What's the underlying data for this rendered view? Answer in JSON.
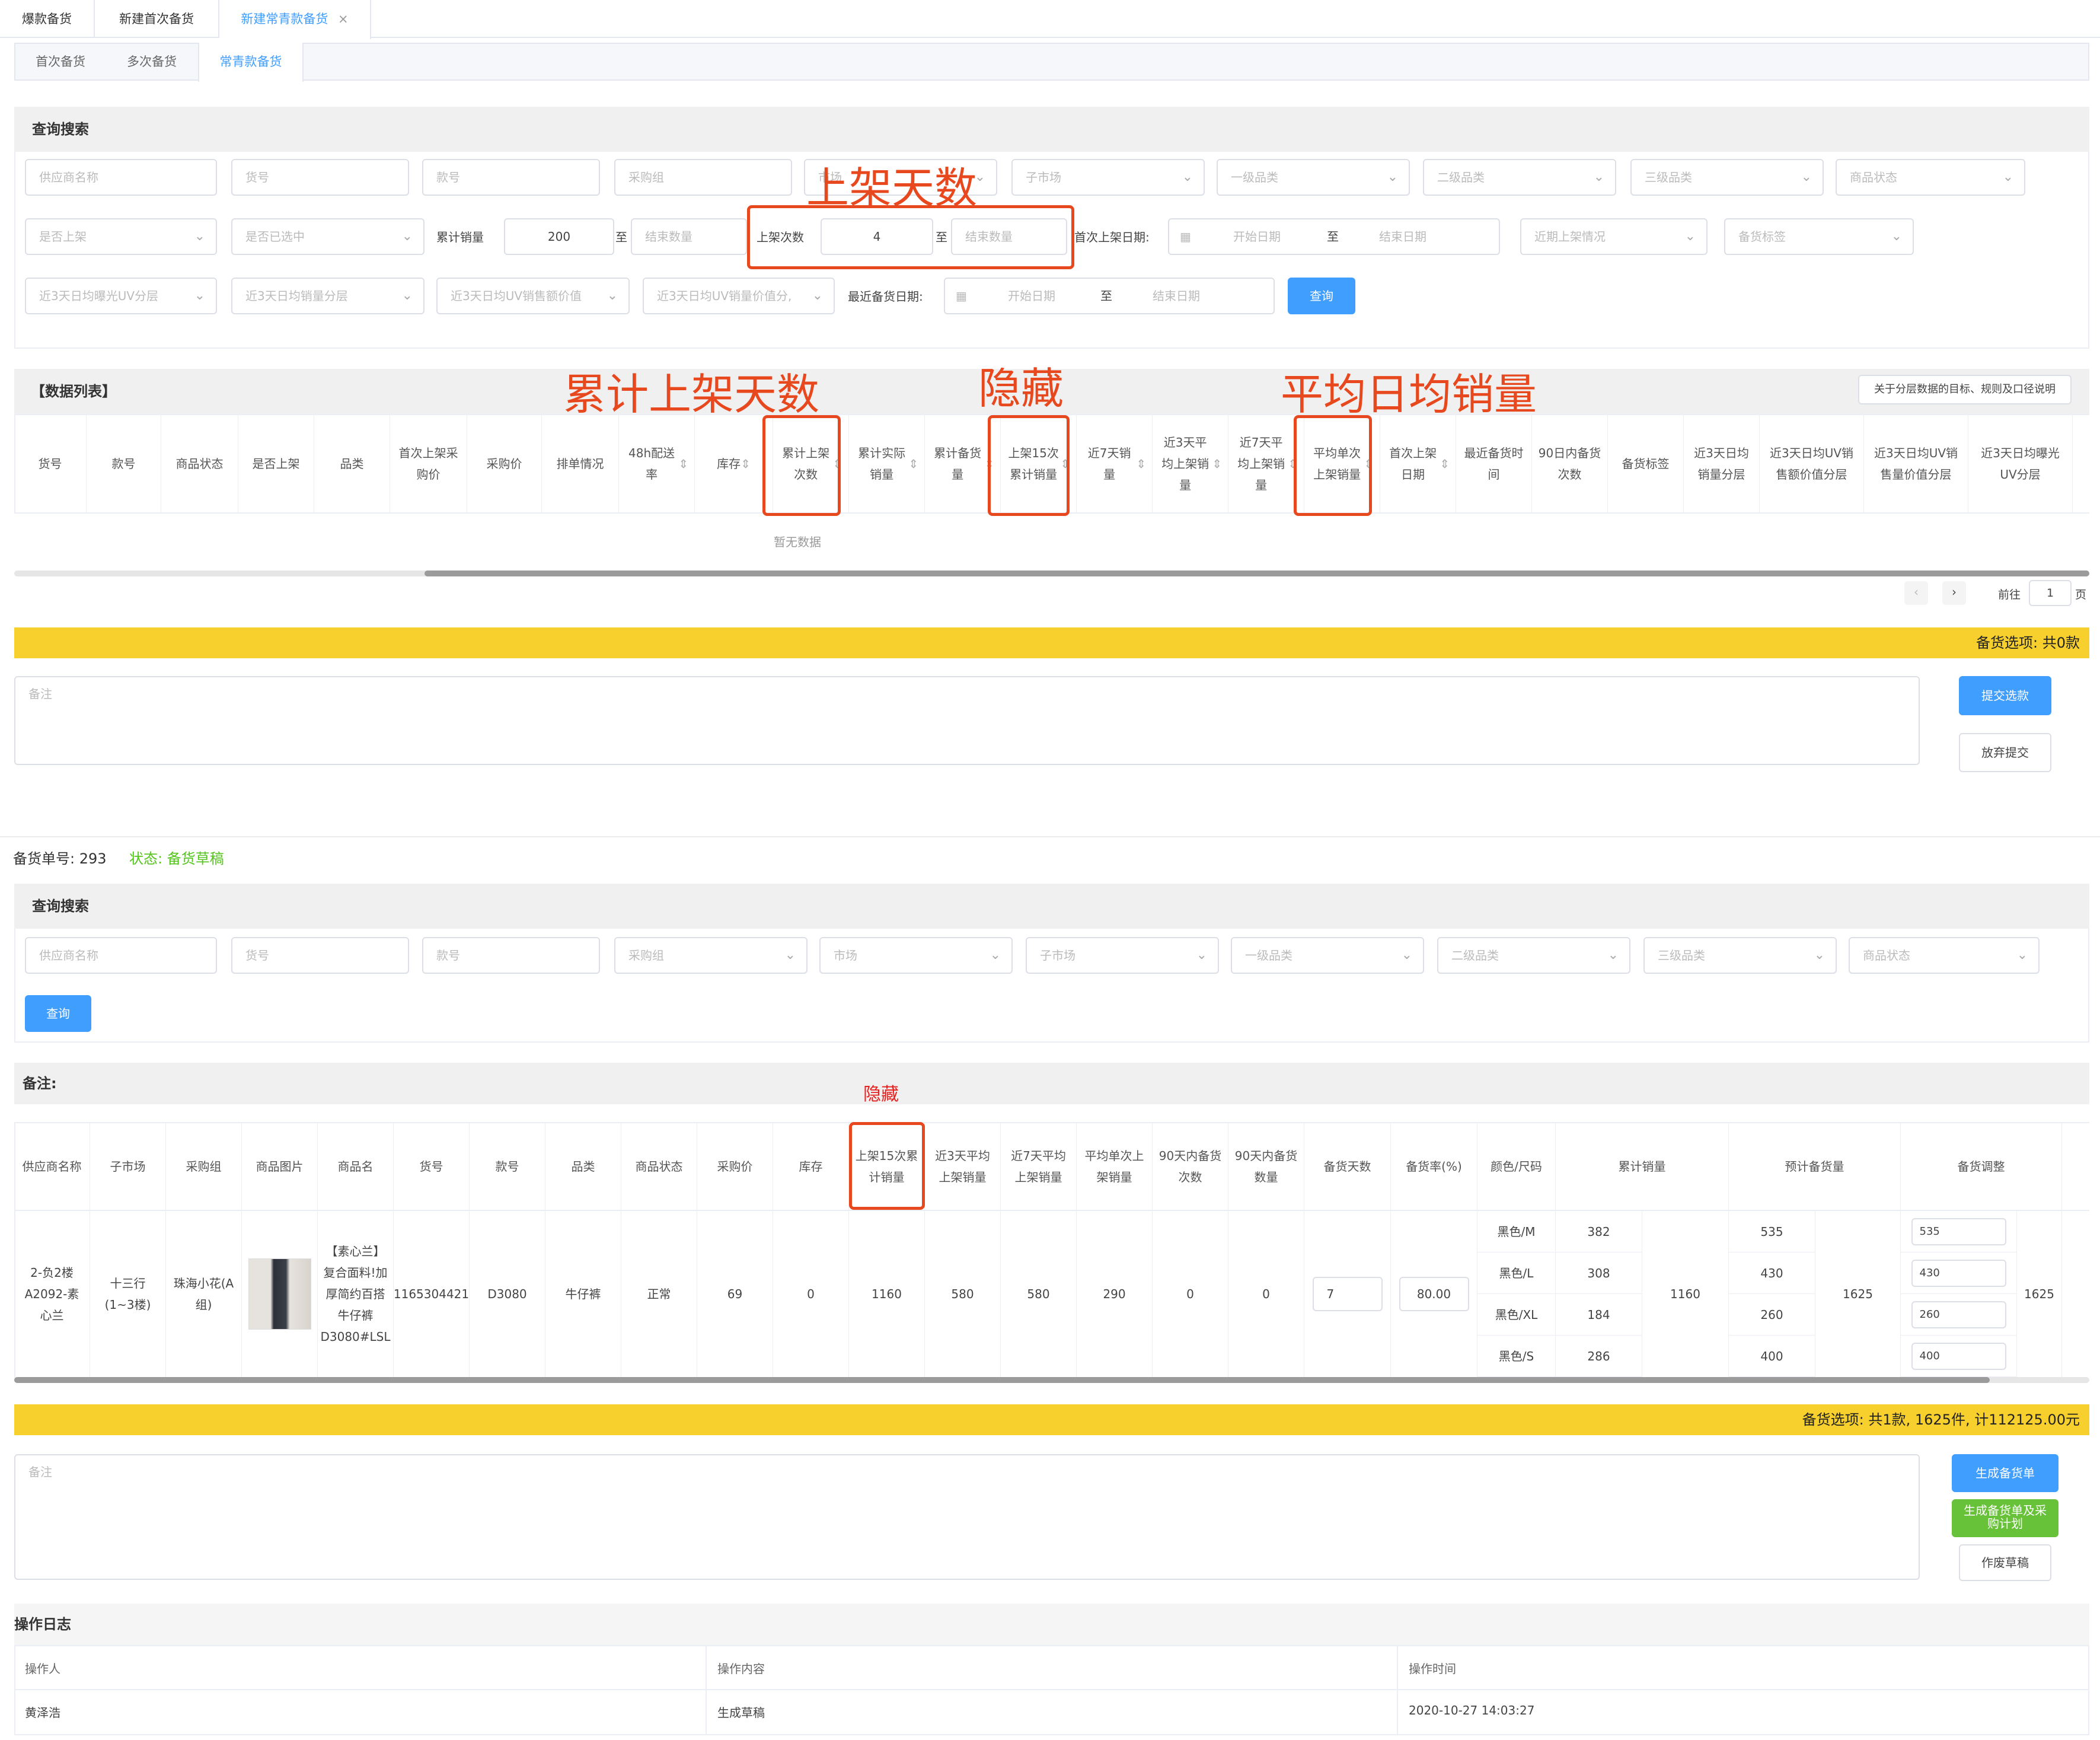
{
  "top_tabs": [
    {
      "label": "爆款备货"
    },
    {
      "label": "新建首次备货"
    },
    {
      "label": "新建常青款备货",
      "close": "×"
    }
  ],
  "sub_tabs": [
    {
      "label": "首次备货"
    },
    {
      "label": "多次备货"
    },
    {
      "label": "常青款备货"
    }
  ],
  "search1": {
    "title": "查询搜索",
    "row1": [
      "供应商名称",
      "货号",
      "款号",
      "采购组",
      "市场",
      "子市场",
      "一级品类",
      "二级品类",
      "三级品类",
      "商品状态"
    ],
    "row2": {
      "is_listed": "是否上架",
      "is_selected": "是否已选中",
      "cum_sales_label": "累计销量",
      "cum_sales_from": "200",
      "to": "至",
      "end_qty": "结束数量",
      "list_count_label": "上架次数",
      "list_count_from": "4",
      "first_list_date_label": "首次上架日期:",
      "start_date": "开始日期",
      "end_date": "结束日期",
      "recent_listing": "近期上架情况",
      "stock_tag": "备货标签"
    },
    "row3": {
      "uv1": "近3天日均曝光UV分层",
      "uv2": "近3天日均销量分层",
      "uv3": "近3天日均UV销售额价值",
      "uv4": "近3天日均UV销量价值分,",
      "recent_stock_date_label": "最近备货日期:",
      "query": "查询"
    }
  },
  "annotations": {
    "days_listed": "上架天数",
    "cum_days_listed": "累计上架天数",
    "hidden": "隐藏",
    "avg_daily_sales": "平均日均销量",
    "hidden_small": "隐藏"
  },
  "datalist": {
    "title": "【数据列表】",
    "explain_button": "关于分层数据的目标、规则及口径说明",
    "headers": [
      "货号",
      "款号",
      "商品状态",
      "是否上架",
      "品类",
      "首次上架采购价",
      "采购价",
      "排单情况",
      "48h配送率",
      "库存",
      "累计上架次数",
      "累计实际销量",
      "累计备货量",
      "上架15次累计销量",
      "近7天销量",
      "近3天平均上架销量",
      "近7天平均上架销量",
      "平均单次上架销量",
      "首次上架日期",
      "最近备货时间",
      "90日内备货次数",
      "备货标签",
      "近3天日均销量分层",
      "近3天日均UV销售额价值分层",
      "近3天日均UV销售量价值分层",
      "近3天日均曝光UV分层"
    ],
    "empty": "暂无数据",
    "pager_goto": "前往",
    "pager_page": "1",
    "pager_unit": "页"
  },
  "bar1": "备货选项: 共0款",
  "remark_placeholder": "备注",
  "btn_submit": "提交选款",
  "btn_abandon": "放弃提交",
  "order": {
    "no_label": "备货单号: 293",
    "status": "状态: 备货草稿"
  },
  "search2": {
    "title": "查询搜索",
    "row1": [
      "供应商名称",
      "货号",
      "款号",
      "采购组",
      "市场",
      "子市场",
      "一级品类",
      "二级品类",
      "三级品类",
      "商品状态"
    ],
    "query": "查询"
  },
  "remark_title": "备注:",
  "table2": {
    "headers": [
      "供应商名称",
      "子市场",
      "采购组",
      "商品图片",
      "商品名",
      "货号",
      "款号",
      "品类",
      "商品状态",
      "采购价",
      "库存",
      "上架15次累计销量",
      "近3天平均上架销量",
      "近7天平均上架销量",
      "平均单次上架销量",
      "90天内备货次数",
      "90天内备货数量",
      "备货天数",
      "备货率(%)",
      "颜色/尺码",
      "累计销量",
      "预计备货量",
      "备货调整"
    ],
    "row": {
      "supplier": "2-负2楼A2092-素心兰",
      "submarket": "十三行(1~3楼)",
      "group": "珠海小花(A组)",
      "name": "【素心兰】复合面料!加厚简约百搭牛仔裤D3080#LSL",
      "sku": "1165304421",
      "style": "D3080",
      "category": "牛仔裤",
      "status": "正常",
      "price": "69",
      "stock": "0",
      "sales15": "1160",
      "avg3": "580",
      "avg7": "580",
      "avg_single": "290",
      "cnt90": "0",
      "qty90": "0",
      "days": "7",
      "rate": "80.00",
      "total_sales": "1160",
      "total_est": "1625",
      "total_adj": "1625",
      "variants": [
        {
          "size": "黑色/M",
          "sales": "382",
          "est": "535",
          "adj": "535"
        },
        {
          "size": "黑色/L",
          "sales": "308",
          "est": "430",
          "adj": "430"
        },
        {
          "size": "黑色/XL",
          "sales": "184",
          "est": "260",
          "adj": "260"
        },
        {
          "size": "黑色/S",
          "sales": "286",
          "est": "400",
          "adj": "400"
        }
      ]
    }
  },
  "bar2": "备货选项: 共1款, 1625件, 计112125.00元",
  "btn_gen": "生成备货单",
  "btn_gen_plan": "生成备货单及采购计划",
  "btn_void": "作废草稿",
  "log": {
    "title": "操作日志",
    "headers": [
      "操作人",
      "操作内容",
      "操作时间"
    ],
    "rows": [
      [
        "黄泽浩",
        "生成草稿",
        "2020-10-27 14:03:27"
      ]
    ]
  },
  "colors": {
    "accent": "#409eff",
    "annotation": "#e8481e",
    "yellow": "#f7d02d",
    "green": "#67c23a",
    "status_green": "#52c41a"
  }
}
